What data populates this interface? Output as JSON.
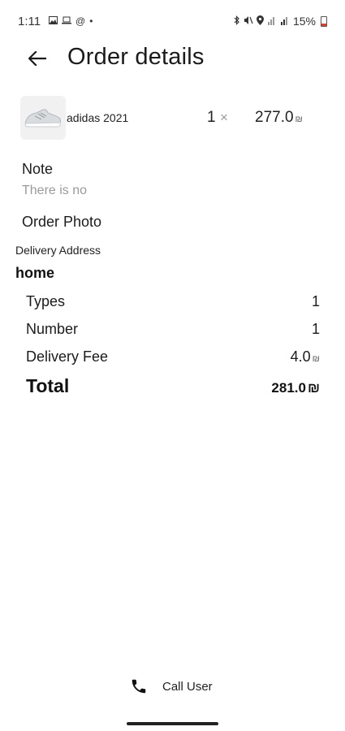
{
  "status_bar": {
    "time": "1:11",
    "battery": "15%",
    "left_icons": [
      "gallery-icon",
      "laptop-icon",
      "at-icon",
      "dot-icon"
    ],
    "right_icons": [
      "bluetooth-icon",
      "mute-icon",
      "location-icon",
      "wifi-icon",
      "signal-icon",
      "battery-icon"
    ]
  },
  "header": {
    "title": "Order details"
  },
  "item": {
    "name": "adidas 2021",
    "quantity": "1",
    "times": "×",
    "price": "277.0",
    "currency": "₪"
  },
  "note": {
    "label": "Note",
    "value": "There is no"
  },
  "order_photo": {
    "label": "Order Photo"
  },
  "delivery_address": {
    "label": "Delivery Address",
    "value": "home"
  },
  "summary": {
    "types_label": "Types",
    "types_value": "1",
    "number_label": "Number",
    "number_value": "1",
    "fee_label": "Delivery Fee",
    "fee_value": "4.0",
    "fee_currency": "₪",
    "total_label": "Total",
    "total_value": "281.0",
    "total_currency": "₪"
  },
  "call_button": {
    "label": "Call User",
    "icon": "phone-icon"
  }
}
